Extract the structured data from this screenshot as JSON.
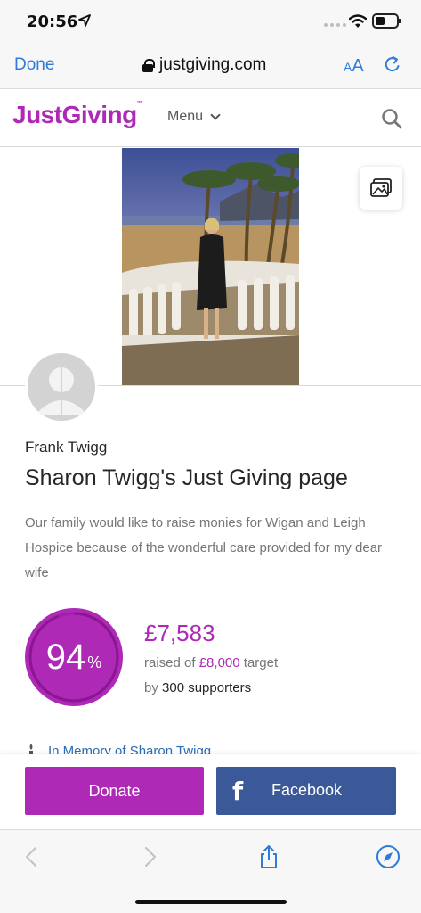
{
  "status_bar": {
    "time": "20:56"
  },
  "browser": {
    "done_label": "Done",
    "url": "justgiving.com",
    "text_size_label": "A",
    "text_size_label_large": "A"
  },
  "site": {
    "logo": "JustGiving",
    "logo_mark": "™",
    "menu_label": "Menu"
  },
  "fundraiser": {
    "owner": "Frank Twigg",
    "title": "Sharon Twigg's Just Giving page",
    "story": "Our family would like to raise monies for Wigan and Leigh Hospice because of the wonderful care provided for my dear wife",
    "progress_percent": 94,
    "percent_sign": "%",
    "raised": "£7,583",
    "raised_prefix": "raised of",
    "target": "£8,000",
    "target_suffix": "target",
    "by_label": "by",
    "supporters": "300 supporters",
    "memory_link": "In Memory of Sharon Twigg"
  },
  "actions": {
    "donate_label": "Donate",
    "facebook_label": "Facebook",
    "facebook_icon_glyph": "f"
  },
  "colors": {
    "brand_purple": "#ad29b6",
    "facebook_blue": "#3b5998",
    "ios_blue": "#2f7bd8"
  },
  "icons": [
    "location-arrow-icon",
    "wifi-icon",
    "battery-icon",
    "lock-icon",
    "reload-icon",
    "search-icon",
    "gallery-icon",
    "avatar-icon",
    "candle-icon",
    "back-icon",
    "forward-icon",
    "share-icon",
    "compass-icon"
  ]
}
